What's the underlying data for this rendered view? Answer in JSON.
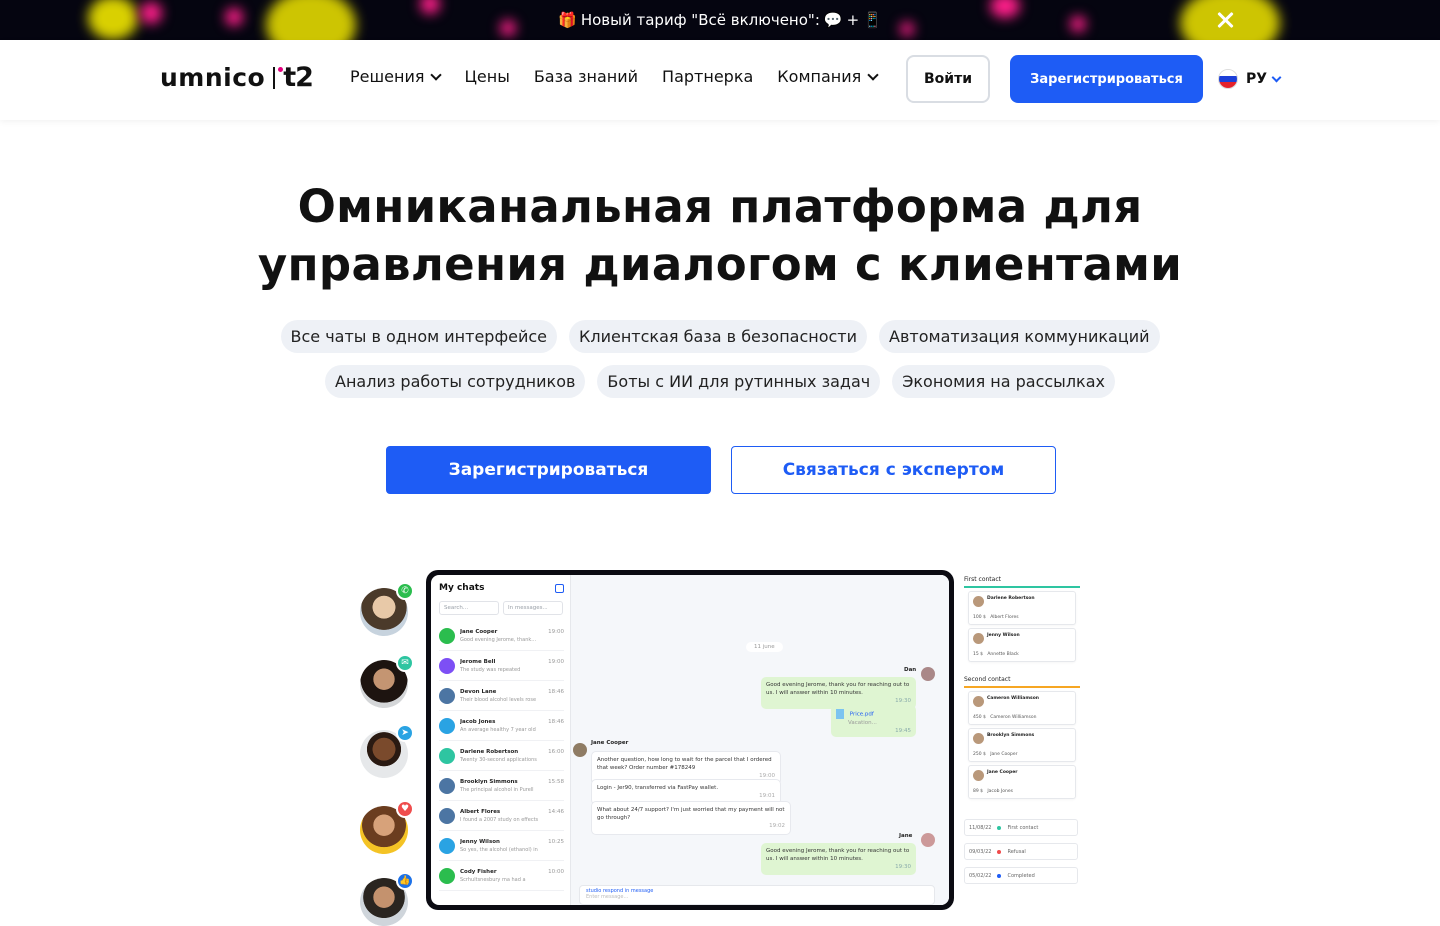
{
  "promo": {
    "text": "Новый тариф \"Всё включено\":",
    "gift_emoji": "🎁",
    "chat_emoji": "💬",
    "plus": "+",
    "phone_emoji": "📱"
  },
  "header": {
    "logo_primary": "umnico",
    "logo_partner": "t2",
    "nav": [
      {
        "label": "Решения",
        "dropdown": true
      },
      {
        "label": "Цены",
        "dropdown": false
      },
      {
        "label": "База знаний",
        "dropdown": false
      },
      {
        "label": "Партнерка",
        "dropdown": false
      },
      {
        "label": "Компания",
        "dropdown": true
      }
    ],
    "login_label": "Войти",
    "register_label": "Зарегистрироваться",
    "language": "РУ"
  },
  "hero": {
    "title_line1": "Омниканальная платформа для",
    "title_line2": "управления диалогом с клиентами",
    "chips_row1": [
      "Все чаты в одном интерфейсе",
      "Клиентская база в безопасности",
      "Автоматизация коммуникаций"
    ],
    "chips_row2": [
      "Анализ работы сотрудников",
      "Боты с ИИ для рутинных задач",
      "Экономия на рассылках"
    ],
    "cta_primary": "Зарегистрироваться",
    "cta_secondary": "Связаться с экспертом"
  },
  "mockup": {
    "chats_title": "My chats",
    "search_placeholder": "Search...",
    "search_scope": "In messages...",
    "chats": [
      {
        "name": "Jane Cooper",
        "time": "19:00",
        "preview": "Good evening Jerome, thank...",
        "channel": "whatsapp"
      },
      {
        "name": "Jerome Bell",
        "time": "19:00",
        "preview": "The study was repeated",
        "channel": "viber"
      },
      {
        "name": "Devon Lane",
        "time": "18:46",
        "preview": "Their blood alcohol levels rose",
        "channel": "vk"
      },
      {
        "name": "Jacob Jones",
        "time": "18:46",
        "preview": "An average healthy 7 year old",
        "channel": "telegram"
      },
      {
        "name": "Darlene Robertson",
        "time": "16:00",
        "preview": "Twenty 30-second applications",
        "channel": "chat"
      },
      {
        "name": "Brooklyn Simmons",
        "time": "15:58",
        "preview": "The principal alcohol in Purell",
        "channel": "vk"
      },
      {
        "name": "Albert Flores",
        "time": "14:46",
        "preview": "I found a 2007 study on effects",
        "channel": "vk"
      },
      {
        "name": "Jenny Wilson",
        "time": "10:25",
        "preview": "So yes, the alcohol (ethanol) in",
        "channel": "telegram"
      },
      {
        "name": "Cody Fisher",
        "time": "10:00",
        "preview": "Scrhultsnesbury ma had a",
        "channel": "whatsapp"
      }
    ],
    "day_label": "11 june",
    "conv": {
      "dan_label": "Dan",
      "dan_msg": "Good evening Jerome, thank you for reaching out to us. I will answer within 10 minutes.",
      "dan_time": "19:30",
      "file_name": "Price.pdf",
      "file_size": "Vacation...",
      "file_time": "19:45",
      "jane_label": "Jane Cooper",
      "jane_msg1": "Another question, how long to wait for the parcel that I ordered that week? Order number #178249",
      "jane_time1": "19:00",
      "jane_msg2": "Login - Jer90, transferred via FastPay wallet.",
      "jane_time2": "19:01",
      "jane_msg3": "What about 24/7 support? I'm just worried that my payment will not go through?",
      "jane_time3": "19:02",
      "agent_label": "Jane",
      "agent_msg": "Good evening Jerome, thank you for reaching out to us. I will answer within 10 minutes.",
      "agent_time": "19:30",
      "composer_hint": "studio respond in message",
      "composer_placeholder": "Enter message..."
    },
    "crm": {
      "col1_title": "First contact",
      "col1_cards": [
        {
          "name": "Darlene Robertson",
          "amount": "100 $",
          "assignee": "Albert Flores"
        },
        {
          "name": "Jenny Wilson",
          "amount": "15 $",
          "assignee": "Annette Black"
        }
      ],
      "col2_title": "Second contact",
      "col2_cards": [
        {
          "name": "Cameron Williamson",
          "amount": "450 $",
          "assignee": "Cameron Williamson"
        },
        {
          "name": "Brooklyn Simmons",
          "amount": "250 $",
          "assignee": "Jane Cooper"
        },
        {
          "name": "Jane Cooper",
          "amount": "89 $",
          "assignee": "Jacob Jones"
        }
      ],
      "history": [
        {
          "date": "11/08/22",
          "status": "First contact",
          "color": "#2ec5a1"
        },
        {
          "date": "09/03/22",
          "status": "Refusal",
          "color": "#f04a4a"
        },
        {
          "date": "05/02/22",
          "status": "Completed",
          "color": "#1e5cf5"
        }
      ]
    }
  },
  "colors": {
    "brand_blue": "#1e5cf5",
    "chip_bg": "#eef1f6",
    "promo_bg": "#050510"
  }
}
